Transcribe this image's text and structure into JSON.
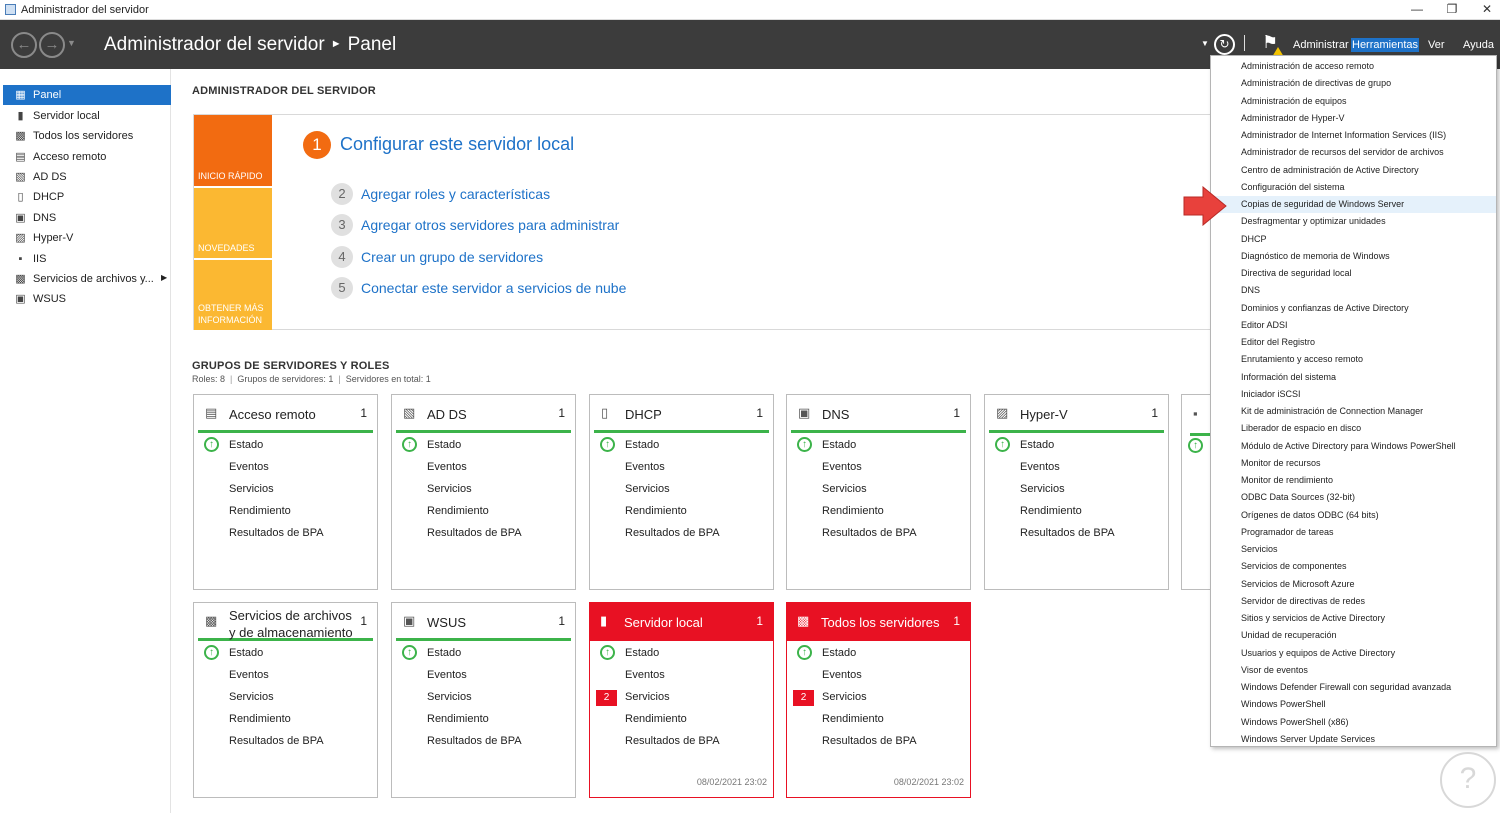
{
  "window": {
    "title": "Administrador del servidor"
  },
  "header": {
    "breadcrumb_root": "Administrador del servidor",
    "breadcrumb_current": "Panel",
    "menus": [
      {
        "label": "Administrar",
        "active": false
      },
      {
        "label": "Herramientas",
        "active": true
      },
      {
        "label": "Ver",
        "active": false
      },
      {
        "label": "Ayuda",
        "active": false
      }
    ]
  },
  "sidebar": {
    "items": [
      {
        "label": "Panel",
        "icon": "dashboard-icon",
        "active": true
      },
      {
        "label": "Servidor local",
        "icon": "server-icon"
      },
      {
        "label": "Todos los servidores",
        "icon": "servers-icon"
      },
      {
        "label": "Acceso remoto",
        "icon": "remote-access-icon"
      },
      {
        "label": "AD DS",
        "icon": "ad-ds-icon"
      },
      {
        "label": "DHCP",
        "icon": "dhcp-icon"
      },
      {
        "label": "DNS",
        "icon": "dns-icon"
      },
      {
        "label": "Hyper-V",
        "icon": "hyper-v-icon"
      },
      {
        "label": "IIS",
        "icon": "iis-icon"
      },
      {
        "label": "Servicios de archivos y...",
        "icon": "file-services-icon",
        "expandable": true
      },
      {
        "label": "WSUS",
        "icon": "wsus-icon"
      }
    ]
  },
  "main": {
    "title": "ADMINISTRADOR DEL SERVIDOR",
    "quick_start": {
      "tiles": [
        "INICIO RÁPIDO",
        "NOVEDADES",
        "OBTENER MÁS INFORMACIÓN"
      ],
      "tile_colors": [
        "#f26b11",
        "#fbb832",
        "#fbb832"
      ],
      "main_step": {
        "num": "1",
        "label": "Configurar este servidor local"
      },
      "steps": [
        {
          "num": "2",
          "label": "Agregar roles y características"
        },
        {
          "num": "3",
          "label": "Agregar otros servidores para administrar"
        },
        {
          "num": "4",
          "label": "Crear un grupo de servidores"
        },
        {
          "num": "5",
          "label": "Conectar este servidor a servicios de nube"
        }
      ]
    },
    "roles": {
      "title": "GRUPOS DE SERVIDORES Y ROLES",
      "roles_count": "Roles: 8",
      "groups_count": "Grupos de servidores: 1",
      "servers_total": "Servidores en total: 1"
    },
    "card_rows": [
      "Estado",
      "Eventos",
      "Servicios",
      "Rendimiento",
      "Resultados de BPA"
    ],
    "cards": [
      {
        "name": "Acceso remoto",
        "count": "1",
        "icon": "remote-access-icon"
      },
      {
        "name": "AD DS",
        "count": "1",
        "icon": "ad-ds-icon"
      },
      {
        "name": "DHCP",
        "count": "1",
        "icon": "dhcp-icon"
      },
      {
        "name": "DNS",
        "count": "1",
        "icon": "dns-icon"
      },
      {
        "name": "Hyper-V",
        "count": "1",
        "icon": "hyper-v-icon"
      },
      {
        "name": "Servicios de archivos y de almacenamiento",
        "count": "1",
        "icon": "file-services-icon"
      },
      {
        "name": "WSUS",
        "count": "1",
        "icon": "wsus-icon"
      },
      {
        "name": "Servidor local",
        "count": "1",
        "icon": "server-icon",
        "alert": true,
        "services_badge": "2",
        "timestamp": "08/02/2021 23:02"
      },
      {
        "name": "Todos los servidores",
        "count": "1",
        "icon": "servers-icon",
        "alert": true,
        "services_badge": "2",
        "timestamp": "08/02/2021 23:02"
      }
    ]
  },
  "tools_menu": {
    "items": [
      "Administración de acceso remoto",
      "Administración de directivas de grupo",
      "Administración de equipos",
      "Administrador de Hyper-V",
      "Administrador de Internet Information Services (IIS)",
      "Administrador de recursos del servidor de archivos",
      "Centro de administración de Active Directory",
      "Configuración del sistema",
      "Copias de seguridad de Windows Server",
      "Desfragmentar y optimizar unidades",
      "DHCP",
      "Diagnóstico de memoria de Windows",
      "Directiva de seguridad local",
      "DNS",
      "Dominios y confianzas de Active Directory",
      "Editor ADSI",
      "Editor del Registro",
      "Enrutamiento y acceso remoto",
      "Información del sistema",
      "Iniciador iSCSI",
      "Kit de administración de Connection Manager",
      "Liberador de espacio en disco",
      "Módulo de Active Directory para Windows PowerShell",
      "Monitor de recursos",
      "Monitor de rendimiento",
      "ODBC Data Sources (32-bit)",
      "Orígenes de datos ODBC (64 bits)",
      "Programador de tareas",
      "Servicios",
      "Servicios de componentes",
      "Servicios de Microsoft Azure",
      "Servidor de directivas de redes",
      "Sitios y servicios de Active Directory",
      "Unidad de recuperación",
      "Usuarios y equipos de Active Directory",
      "Visor de eventos",
      "Windows Defender Firewall con seguridad avanzada",
      "Windows PowerShell",
      "Windows PowerShell (x86)",
      "Windows Server Update Services"
    ],
    "highlighted_index": 8
  },
  "colors": {
    "accent": "#1e72c8",
    "header_bg": "#3c3c3c",
    "ok_green": "#3cb34a",
    "alert_red": "#e81123",
    "pointer_red": "#e8413c"
  }
}
